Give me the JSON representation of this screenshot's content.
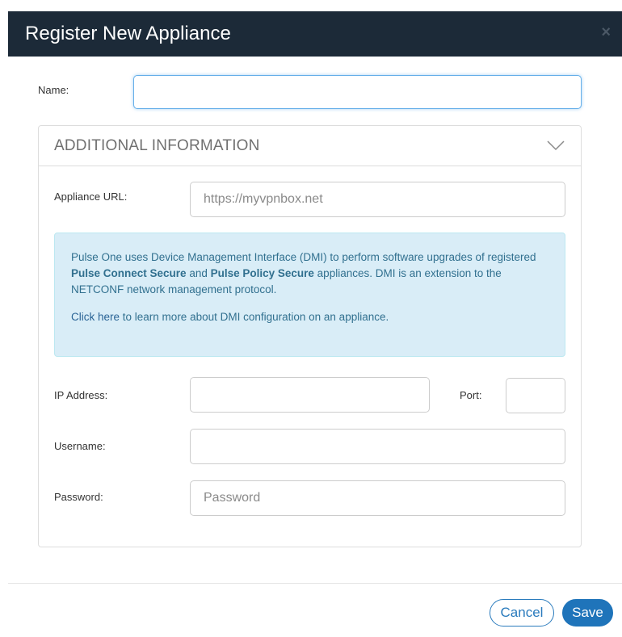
{
  "dialog": {
    "title": "Register New Appliance",
    "close_glyph": "×"
  },
  "name_field": {
    "label": "Name:",
    "value": "",
    "placeholder": ""
  },
  "additional_info": {
    "header": "ADDITIONAL INFORMATION",
    "expanded": true,
    "chevron_icon": "chevron-down-icon",
    "appliance_url": {
      "label": "Appliance URL:",
      "value": "",
      "placeholder": "https://myvpnbox.net"
    },
    "info": {
      "line1_pre": "Pulse One uses Device Management Interface (DMI) to perform software upgrades of registered ",
      "product1": "Pulse Connect Secure",
      "line1_mid": " and ",
      "product2": "Pulse Policy Secure",
      "line1_post": " appliances. DMI is an extension to the NETCONF network management protocol.",
      "link_text": "Click here",
      "link_post": " to learn more about DMI configuration on an appliance."
    },
    "ip_address": {
      "label": "IP Address:",
      "value": ""
    },
    "port": {
      "label": "Port:",
      "value": ""
    },
    "username": {
      "label": "Username:",
      "value": ""
    },
    "password": {
      "label": "Password:",
      "value": "",
      "placeholder": "Password"
    }
  },
  "footer": {
    "cancel_label": "Cancel",
    "save_label": "Save"
  },
  "colors": {
    "title_bar": "#1c2a38",
    "primary": "#1f74ba",
    "info_bg": "#d9edf7",
    "info_text": "#31708f"
  }
}
